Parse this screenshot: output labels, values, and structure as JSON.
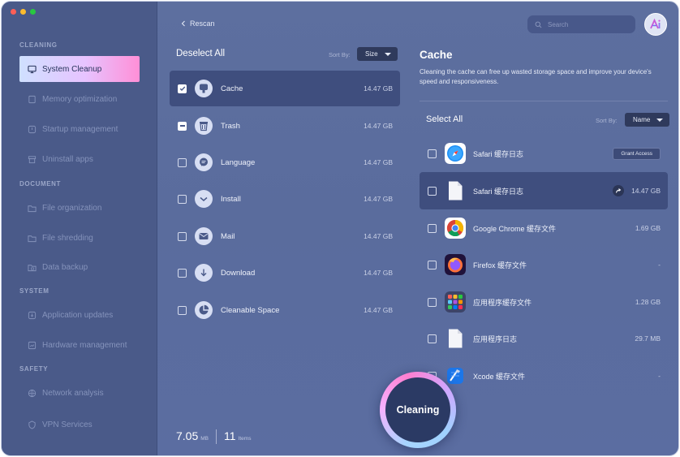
{
  "sidebar": {
    "sections": [
      {
        "title": "CLEANING",
        "items": [
          {
            "label": "System Cleanup",
            "icon": "monitor-icon",
            "active": true
          },
          {
            "label": "Memory optimization",
            "icon": "memory-icon"
          },
          {
            "label": "Startup management",
            "icon": "power-icon"
          },
          {
            "label": "Uninstall apps",
            "icon": "trash-icon"
          }
        ]
      },
      {
        "title": "DOCUMENT",
        "items": [
          {
            "label": "File organization",
            "icon": "folder-icon"
          },
          {
            "label": "File shredding",
            "icon": "folder-shred-icon"
          },
          {
            "label": "Data backup",
            "icon": "folder-backup-icon"
          }
        ]
      },
      {
        "title": "SYSTEM",
        "items": [
          {
            "label": "Application updates",
            "icon": "update-icon"
          },
          {
            "label": "Hardware management",
            "icon": "hardware-icon"
          }
        ]
      },
      {
        "title": "SAFETY",
        "items": [
          {
            "label": "Network analysis",
            "icon": "globe-icon"
          },
          {
            "label": "VPN Services",
            "icon": "vpn-icon"
          }
        ]
      }
    ]
  },
  "middle": {
    "rescan_label": "Rescan",
    "deselect_label": "Deselect All",
    "sort_label": "Sort By:",
    "sort_value": "Size",
    "categories": [
      {
        "name": "Cache",
        "size": "14.47 GB",
        "state": "checked",
        "icon": "cache-icon",
        "active": true
      },
      {
        "name": "Trash",
        "size": "14.47 GB",
        "state": "partial",
        "icon": "trash-bin-icon"
      },
      {
        "name": "Language",
        "size": "14.47 GB",
        "state": "unchecked",
        "icon": "language-icon"
      },
      {
        "name": "Install",
        "size": "14.47 GB",
        "state": "unchecked",
        "icon": "install-icon"
      },
      {
        "name": "Mail",
        "size": "14.47 GB",
        "state": "unchecked",
        "icon": "mail-icon"
      },
      {
        "name": "Download",
        "size": "14.47 GB",
        "state": "unchecked",
        "icon": "download-icon"
      },
      {
        "name": "Cleanable Space",
        "size": "14.47 GB",
        "state": "unchecked",
        "icon": "pie-icon"
      }
    ],
    "summary": {
      "size_value": "7.05",
      "size_unit": "MB",
      "count_value": "11",
      "count_unit": "Items"
    }
  },
  "right": {
    "search_placeholder": "Search",
    "title": "Cache",
    "description": "Cleaning the cache can free up wasted storage space and improve your device's speed and responsiveness.",
    "select_all_label": "Select All",
    "sort_label": "Sort By:",
    "sort_value": "Name",
    "files": [
      {
        "name": "Safari 缓存日志",
        "size": "",
        "action": "Grant Access",
        "icon": "safari-icon"
      },
      {
        "name": "Safari 缓存日志",
        "size": "14.47 GB",
        "share": true,
        "icon": "document-icon",
        "active": true
      },
      {
        "name": "Google Chrome 缓存文件",
        "size": "1.69 GB",
        "icon": "chrome-icon"
      },
      {
        "name": "Firefox 缓存文件",
        "size": "-",
        "icon": "firefox-icon"
      },
      {
        "name": "应用程序缓存文件",
        "size": "1.28 GB",
        "icon": "app-grid-icon"
      },
      {
        "name": "应用程序日志",
        "size": "29.7 MB",
        "icon": "document-icon"
      },
      {
        "name": "Xcode 缓存文件",
        "size": "-",
        "icon": "xcode-icon"
      }
    ]
  },
  "cleaning_button_label": "Cleaning",
  "colors": {
    "window_bg": "#5d6f9f",
    "sidebar_bg": "#4a5a89",
    "active_row": "#3f4e7e",
    "accent_gradient_start": "#cfe0ff",
    "accent_gradient_end": "#ff8fd7",
    "button_bg": "#2b3a64"
  }
}
